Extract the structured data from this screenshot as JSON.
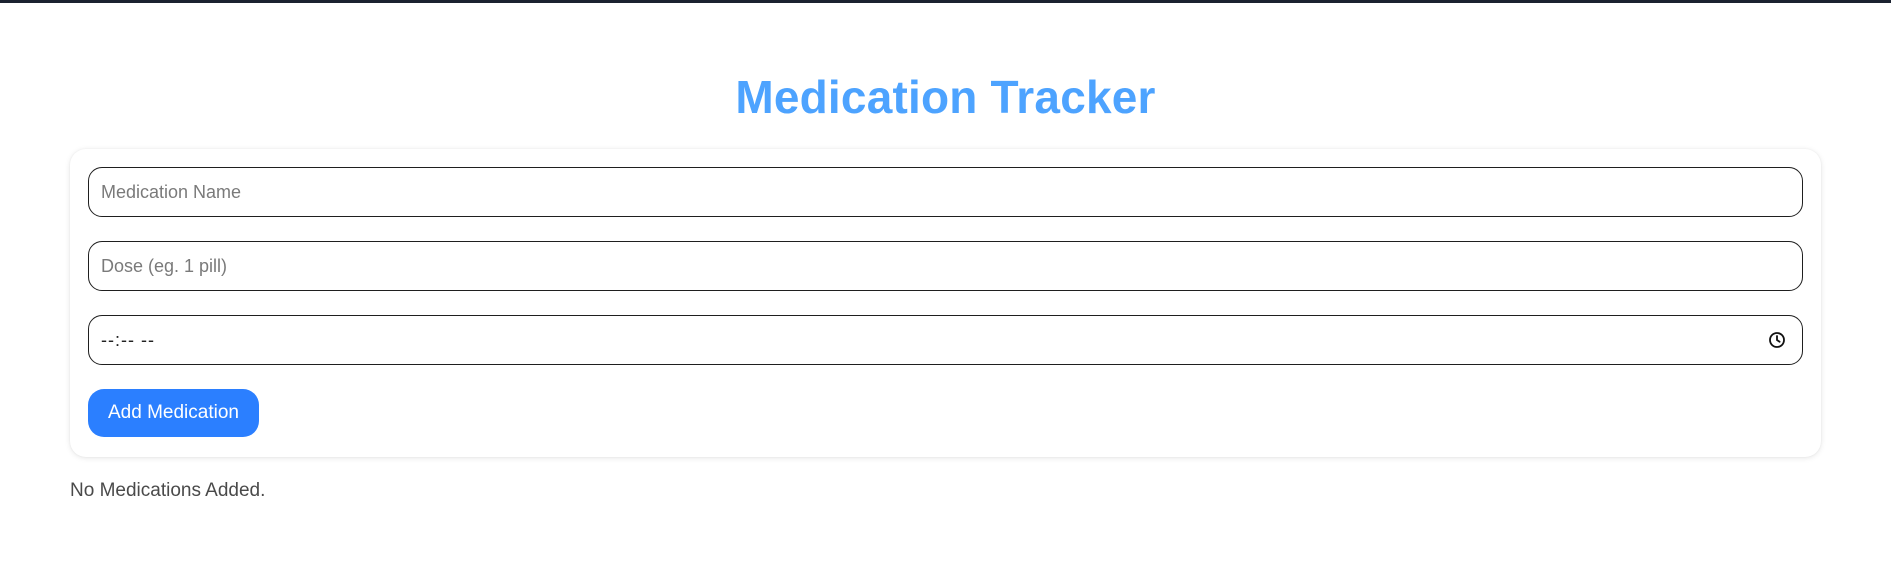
{
  "header": {
    "title": "Medication Tracker"
  },
  "form": {
    "name_placeholder": "Medication Name",
    "dose_placeholder": "Dose (eg. 1 pill)",
    "time_value": "--:-- --",
    "add_button_label": "Add Medication"
  },
  "list": {
    "empty_message": "No Medications Added."
  },
  "colors": {
    "title": "#4da3ff",
    "button": "#2b7fff",
    "top_bar": "#1b2230"
  },
  "icons": {
    "time_picker": "clock-icon"
  }
}
